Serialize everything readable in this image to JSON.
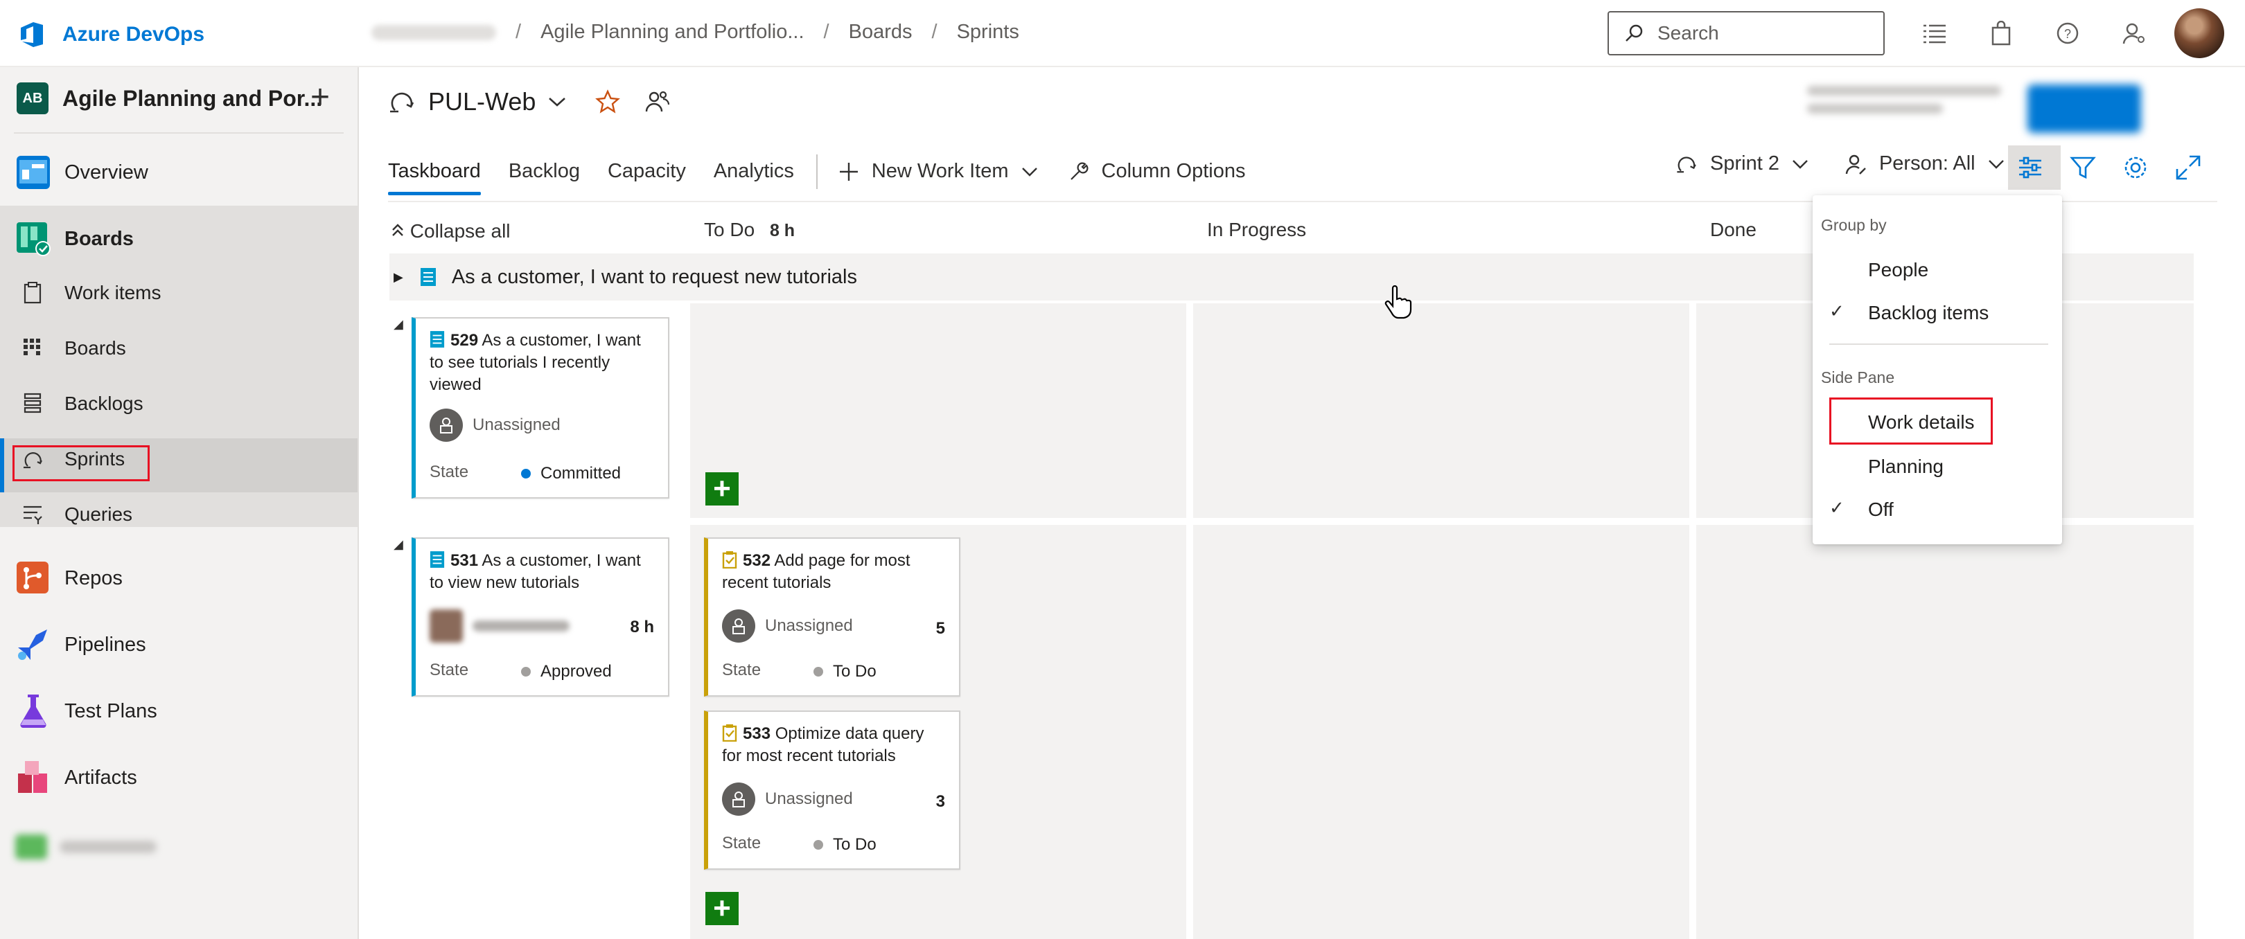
{
  "app": {
    "title": "Azure DevOps",
    "breadcrumbs": [
      "Agile Planning and Portfolio...",
      "Boards",
      "Sprints"
    ],
    "search_placeholder": "Search"
  },
  "sidebar": {
    "project_initials": "AB",
    "project_name": "Agile Planning and Por...",
    "items": [
      {
        "label": "Overview",
        "icon": "overview-icon"
      },
      {
        "label": "Boards",
        "icon": "boards-icon"
      },
      {
        "label": "Repos",
        "icon": "repos-icon"
      },
      {
        "label": "Pipelines",
        "icon": "pipelines-icon"
      },
      {
        "label": "Test Plans",
        "icon": "test-plans-icon"
      },
      {
        "label": "Artifacts",
        "icon": "artifacts-icon"
      }
    ],
    "board_subitems": [
      {
        "label": "Work items",
        "icon": "work-items-icon"
      },
      {
        "label": "Boards",
        "icon": "board-grid-icon"
      },
      {
        "label": "Backlogs",
        "icon": "backlogs-icon"
      },
      {
        "label": "Sprints",
        "icon": "sprints-icon"
      },
      {
        "label": "Queries",
        "icon": "queries-icon"
      }
    ]
  },
  "header": {
    "team_name": "PUL-Web",
    "tabs": [
      "Taskboard",
      "Backlog",
      "Capacity",
      "Analytics"
    ],
    "active_tab": "Taskboard",
    "new_work_item": "New Work Item",
    "column_options": "Column Options",
    "sprint": "Sprint 2",
    "person_filter": "Person: All"
  },
  "board": {
    "collapse_all": "Collapse all",
    "columns": [
      {
        "name": "To Do",
        "hours": "8 h"
      },
      {
        "name": "In Progress",
        "hours": ""
      },
      {
        "name": "Done",
        "hours": ""
      }
    ],
    "unparented_row": "As a customer, I want to request new tutorials",
    "state_label": "State",
    "cards": [
      {
        "id": "529",
        "title": "As a customer, I want to see tutorials I recently viewed",
        "assignee": "Unassigned",
        "hours": "",
        "state": "Committed",
        "state_color": "#0078d4",
        "type": "story"
      },
      {
        "id": "531",
        "title": "As a customer, I want to view new tutorials",
        "assignee": "",
        "hours": "8 h",
        "state": "Approved",
        "state_color": "#a19f9d",
        "type": "story"
      },
      {
        "id": "532",
        "title": "Add page for most recent tutorials",
        "assignee": "Unassigned",
        "hours": "5",
        "state": "To Do",
        "state_color": "#a19f9d",
        "type": "task"
      },
      {
        "id": "533",
        "title": "Optimize data query for most recent tutorials",
        "assignee": "Unassigned",
        "hours": "3",
        "state": "To Do",
        "state_color": "#a19f9d",
        "type": "task"
      }
    ]
  },
  "dropdown": {
    "group_by_label": "Group by",
    "group_by_options": [
      {
        "label": "People",
        "checked": false
      },
      {
        "label": "Backlog items",
        "checked": true
      }
    ],
    "side_pane_label": "Side Pane",
    "side_pane_options": [
      {
        "label": "Work details",
        "checked": false
      },
      {
        "label": "Planning",
        "checked": false
      },
      {
        "label": "Off",
        "checked": true
      }
    ]
  },
  "colors": {
    "accent": "#0078d4",
    "story_bar": "#009ccc",
    "task_bar": "#c9a10a",
    "add_button": "#107c10",
    "highlight_box": "#e81123"
  }
}
